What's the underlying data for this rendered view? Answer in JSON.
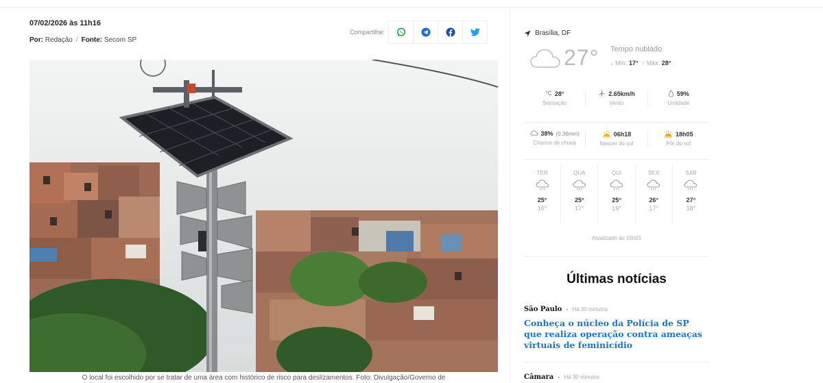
{
  "article": {
    "date": "07/02/2026 às 11h16",
    "byline_by_label": "Por:",
    "byline_author": "Redação",
    "byline_separator": "/",
    "byline_source_label": "Fonte:",
    "byline_source": "Secom SP",
    "share_label": "Compartilhe:",
    "share_buttons": [
      {
        "icon": "whatsapp-icon",
        "color": "#25a14b"
      },
      {
        "icon": "telegram-icon",
        "color": "#1a73c8"
      },
      {
        "icon": "facebook-icon",
        "color": "#1b4fa8"
      },
      {
        "icon": "twitter-icon",
        "color": "#1da1f2"
      }
    ],
    "caption": "O local foi escolhido por se tratar de uma área com histórico de risco para deslizamentos. Foto: Divulgação/Governo de"
  },
  "weather": {
    "location": "Brasília, DF",
    "temperature": "27°",
    "condition": "Tempo nublado",
    "min_label": "Mín.",
    "min_value": "17°",
    "max_label": "Máx.",
    "max_value": "28°",
    "feels_like": {
      "value": "28°",
      "label": "Sensação"
    },
    "wind": {
      "value": "2.65km/h",
      "label": "Vento"
    },
    "humidity": {
      "value": "59%",
      "label": "Umidade"
    },
    "rain": {
      "value": "38%",
      "detail": "(0.36mm)",
      "label": "Chance de chuva"
    },
    "sunrise": {
      "value": "06h18",
      "label": "Nascer do sol"
    },
    "sunset": {
      "value": "18h05",
      "label": "Pôr do sol"
    },
    "forecast": [
      {
        "day": "TER",
        "max": "25°",
        "min": "16°"
      },
      {
        "day": "QUA",
        "max": "25°",
        "min": "17°"
      },
      {
        "day": "QUI",
        "max": "25°",
        "min": "19°"
      },
      {
        "day": "SEX",
        "max": "26°",
        "min": "17°"
      },
      {
        "day": "SÁB",
        "max": "27°",
        "min": "18°"
      }
    ],
    "updated": "Atualizado às 15h01"
  },
  "news": {
    "title": "Últimas notícias",
    "items": [
      {
        "category": "São Paulo",
        "time": "Há 30 minutos",
        "headline": "Conheça o núcleo da Polícia de SP que realiza operação contra ameaças virtuais de feminicídio"
      },
      {
        "category": "Câmara",
        "time": "Há 30 minutos"
      }
    ],
    "headline_color": "#1a73c8"
  }
}
